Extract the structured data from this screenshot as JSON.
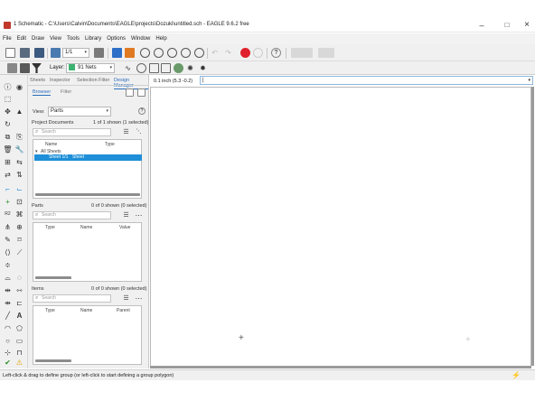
{
  "window": {
    "title": "1 Schematic - C:\\Users\\Calvin\\Documents\\EAGLE\\projects\\Dozuki\\untitled.sch - EAGLE 9.6.2 free",
    "minimize": "–",
    "maximize": "□",
    "close": "×"
  },
  "menu": [
    "File",
    "Edit",
    "Draw",
    "View",
    "Tools",
    "Library",
    "Options",
    "Window",
    "Help"
  ],
  "toolbar": {
    "sheet_select": "1/1",
    "layer_label": "Layer:",
    "layer_value": "91 Nets",
    "layer_color": "#3cb371"
  },
  "panel": {
    "tabs": [
      "Sheets",
      "Inspector",
      "Selection Filter",
      "Design Manager"
    ],
    "subtabs": [
      "Browser",
      "Filter"
    ],
    "view_label": "View:",
    "view_value": "Parts",
    "help": "?",
    "project_docs": {
      "label": "Project Documents",
      "count": "1 of 1 shown (1 selected)",
      "search_placeholder": "Search",
      "col_name": "Name",
      "col_type": "Type",
      "tree_root": "All Sheets",
      "tree_item_name": "Sheet 1/1",
      "tree_item_type": "Sheet"
    },
    "parts": {
      "label": "Parts",
      "count": "0 of 0 shown (0 selected)",
      "search_placeholder": "Search",
      "col_type": "Type",
      "col_name": "Name",
      "col_value": "Value"
    },
    "items": {
      "label": "Items",
      "count": "0 of 0 shown (0 selected)",
      "search_placeholder": "Search",
      "col_type": "Type",
      "col_name": "Name",
      "col_parent": "Parent"
    }
  },
  "command": {
    "coords": "0.1 inch (5.3 -0.2)",
    "input_value": "|"
  },
  "status": {
    "text": "Left-click & drag to define group (or left-click to start defining a group polygon)"
  },
  "colors": {
    "accent": "#2a6ebd",
    "selection": "#1e8fd8",
    "stop": "#e0202a"
  }
}
